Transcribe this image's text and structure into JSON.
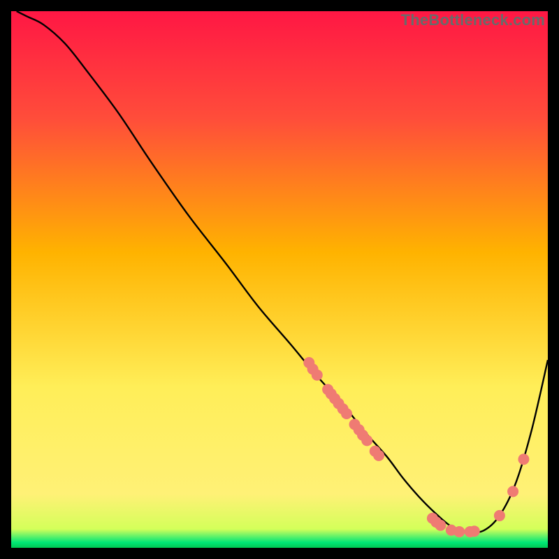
{
  "watermark": "TheBottleneck.com",
  "chart_data": {
    "type": "line",
    "title": "",
    "xlabel": "",
    "ylabel": "",
    "xlim": [
      0,
      100
    ],
    "ylim": [
      0,
      100
    ],
    "grid": false,
    "legend": false,
    "background_gradient": {
      "stops": [
        {
          "offset": 0.0,
          "color": "#ff1744"
        },
        {
          "offset": 0.2,
          "color": "#ff4d3a"
        },
        {
          "offset": 0.45,
          "color": "#ffb300"
        },
        {
          "offset": 0.7,
          "color": "#ffee58"
        },
        {
          "offset": 0.9,
          "color": "#fff176"
        },
        {
          "offset": 0.965,
          "color": "#d4ff5a"
        },
        {
          "offset": 0.99,
          "color": "#00e676"
        },
        {
          "offset": 1.0,
          "color": "#00c853"
        }
      ]
    },
    "series": [
      {
        "name": "bottleneck-curve",
        "x": [
          1,
          3,
          6,
          10,
          14,
          20,
          26,
          33,
          40,
          46,
          52,
          57,
          62,
          66,
          70,
          73,
          76,
          79,
          82,
          85,
          88,
          91,
          94,
          97,
          100
        ],
        "y": [
          100,
          99,
          97.5,
          94,
          89,
          81,
          72,
          62,
          53,
          45,
          38,
          32,
          26.5,
          21.5,
          17,
          13,
          9.5,
          6.5,
          4,
          3,
          3.2,
          6,
          12,
          22,
          35
        ]
      }
    ],
    "marker_points": [
      {
        "x": 55.5,
        "y": 34.5
      },
      {
        "x": 56.2,
        "y": 33.3
      },
      {
        "x": 57.0,
        "y": 32.2
      },
      {
        "x": 59.0,
        "y": 29.5
      },
      {
        "x": 59.6,
        "y": 28.7
      },
      {
        "x": 60.3,
        "y": 27.8
      },
      {
        "x": 61.0,
        "y": 26.9
      },
      {
        "x": 61.8,
        "y": 25.9
      },
      {
        "x": 62.5,
        "y": 25.0
      },
      {
        "x": 64.0,
        "y": 23.0
      },
      {
        "x": 64.8,
        "y": 22.0
      },
      {
        "x": 65.5,
        "y": 21.0
      },
      {
        "x": 66.3,
        "y": 20.0
      },
      {
        "x": 67.8,
        "y": 18.0
      },
      {
        "x": 68.5,
        "y": 17.2
      },
      {
        "x": 78.5,
        "y": 5.5
      },
      {
        "x": 79.2,
        "y": 4.8
      },
      {
        "x": 80.0,
        "y": 4.2
      },
      {
        "x": 82.0,
        "y": 3.3
      },
      {
        "x": 83.5,
        "y": 3.0
      },
      {
        "x": 85.5,
        "y": 3.0
      },
      {
        "x": 86.3,
        "y": 3.1
      },
      {
        "x": 91.0,
        "y": 6.0
      },
      {
        "x": 93.5,
        "y": 10.5
      },
      {
        "x": 95.5,
        "y": 16.5
      }
    ],
    "marker_style": {
      "radius_px": 8,
      "fill": "#ef7b73"
    },
    "curve_style": {
      "stroke": "#000000",
      "stroke_width_px": 2.4
    }
  }
}
